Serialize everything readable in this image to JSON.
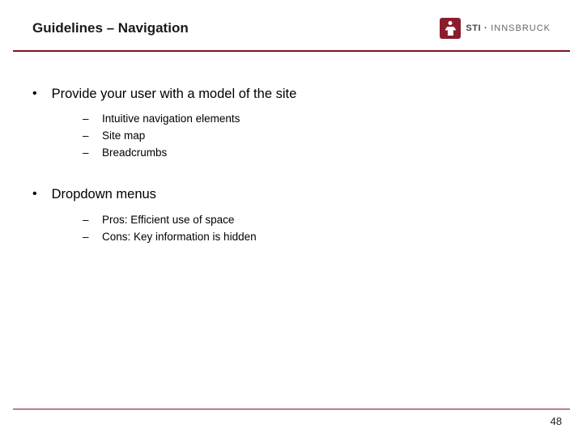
{
  "header": {
    "title": "Guidelines – Navigation",
    "logo": {
      "sti": "STI",
      "dot": "·",
      "inns": "INNSBRUCK"
    }
  },
  "content": {
    "bullets": [
      {
        "text": "Provide your user with a model of the site",
        "subs": [
          "Intuitive navigation elements",
          "Site map",
          "Breadcrumbs"
        ]
      },
      {
        "text": "Dropdown menus",
        "subs": [
          "Pros: Efficient use of space",
          "Cons: Key information is hidden"
        ]
      }
    ]
  },
  "footer": {
    "page": "48"
  }
}
